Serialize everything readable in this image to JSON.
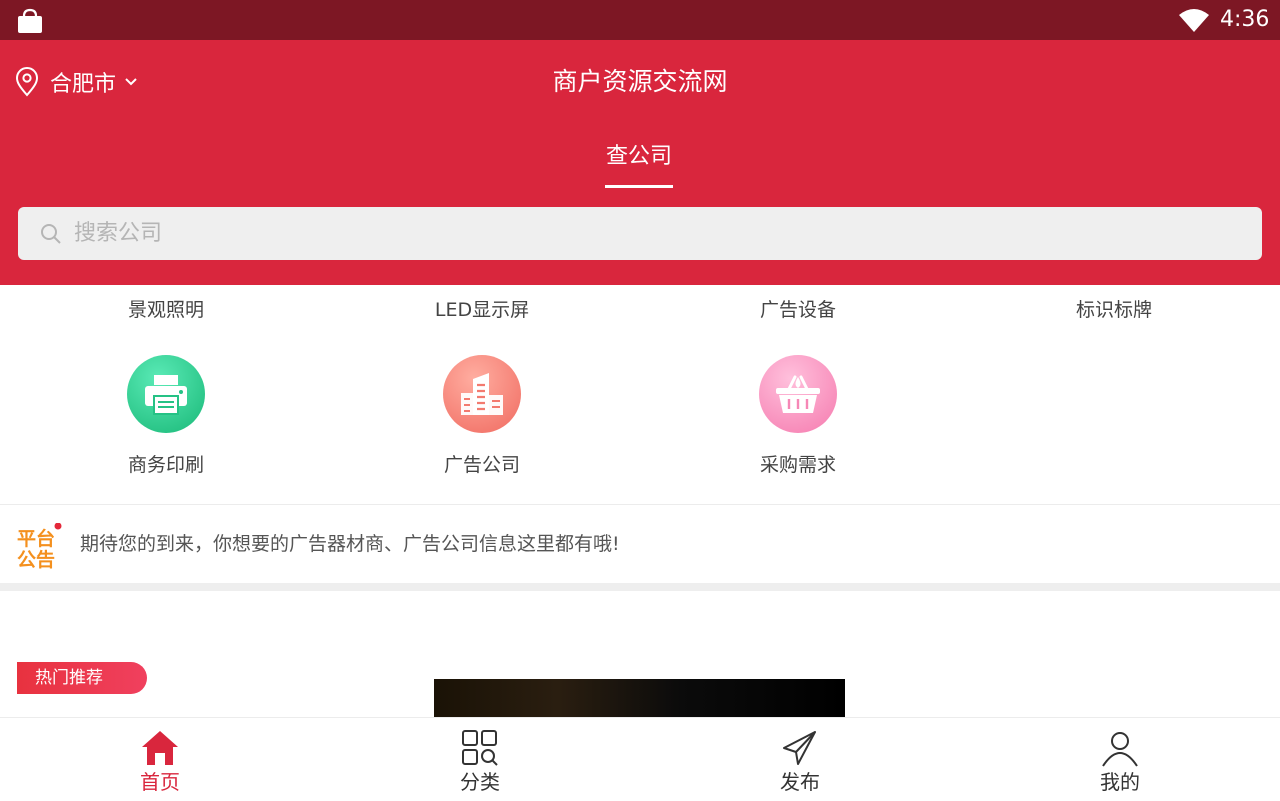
{
  "status_bar": {
    "time": "4:36",
    "icons": [
      "shopping-bag-icon",
      "wifi-icon"
    ]
  },
  "header": {
    "city": "合肥市",
    "title": "商户资源交流网",
    "tab": "查公司",
    "search_placeholder": "搜索公司"
  },
  "categories_top": [
    "景观照明",
    "LED显示屏",
    "广告设备",
    "标识标牌"
  ],
  "categories_grid": [
    {
      "label": "商务印刷",
      "icon": "printer-icon",
      "colors": [
        "#48e0a8",
        "#1dbf7c"
      ]
    },
    {
      "label": "广告公司",
      "icon": "buildings-icon",
      "colors": [
        "#ff9a8c",
        "#f36b63"
      ]
    },
    {
      "label": "采购需求",
      "icon": "basket-icon",
      "colors": [
        "#ffb0d2",
        "#f67fb0"
      ]
    }
  ],
  "notice": {
    "logo_text": "平台公告",
    "text": "期待您的到来，你想要的广告器材商、广告公司信息这里都有哦!"
  },
  "hot": {
    "label": "热门推荐"
  },
  "bottom_nav": [
    {
      "label": "首页",
      "icon": "home-icon",
      "active": true
    },
    {
      "label": "分类",
      "icon": "grid-search-icon",
      "active": false
    },
    {
      "label": "发布",
      "icon": "send-icon",
      "active": false
    },
    {
      "label": "我的",
      "icon": "user-icon",
      "active": false
    }
  ],
  "colors": {
    "brand_red": "#d9263d",
    "status_bar": "#7d1724",
    "notice_orange": "#f4901e"
  }
}
